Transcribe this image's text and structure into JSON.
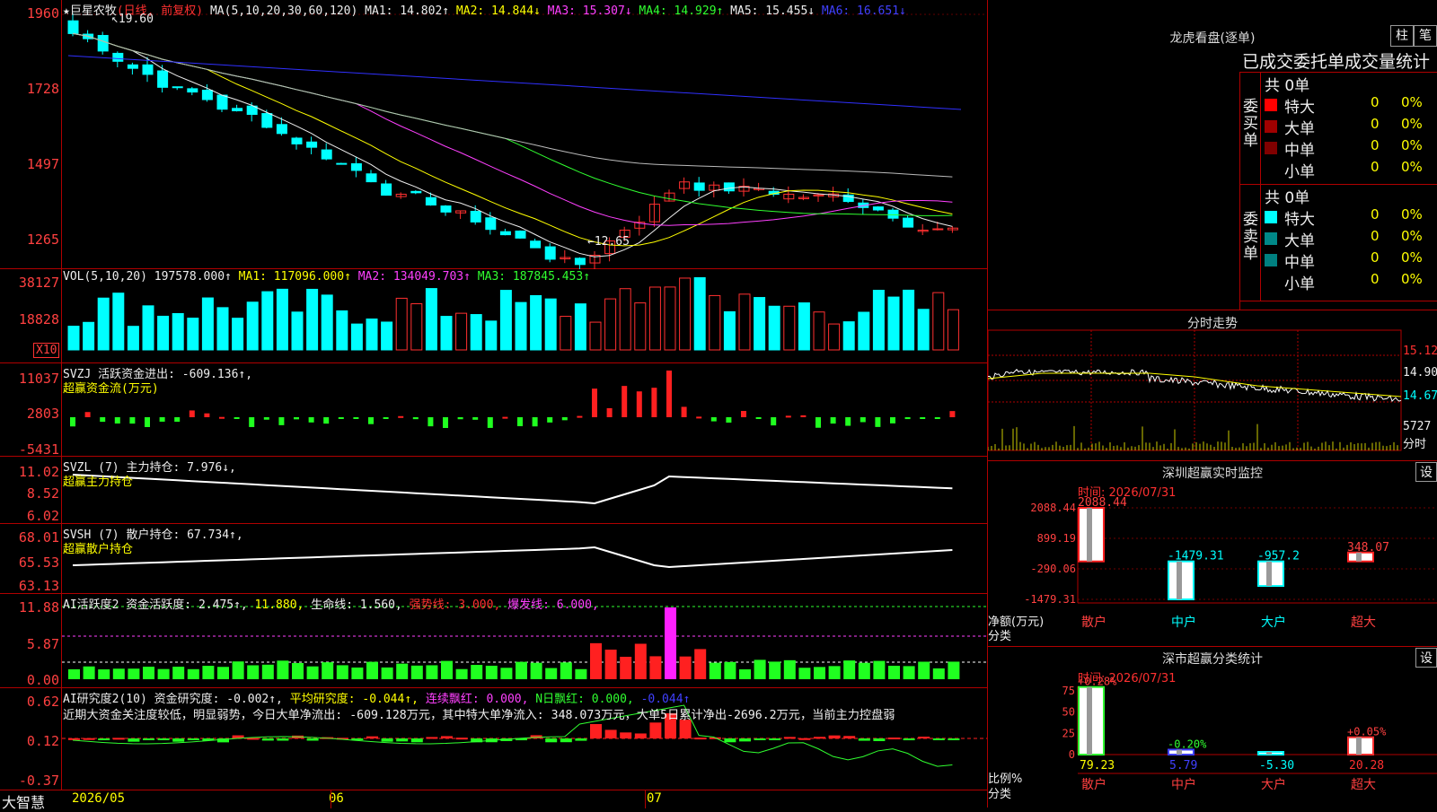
{
  "stock": {
    "name": "★巨星农牧",
    "period": "(日线, 前复权)",
    "ma_label": "MA(5,10,20,30,60,120)",
    "ma1": "MA1: 14.802↑",
    "ma2": "MA2: 14.844↓",
    "ma3": "MA3: 15.307↓",
    "ma4": "MA4: 14.929↑",
    "ma5": "MA5: 15.455↓",
    "ma6": "MA6: 16.651↓",
    "high_mark": "19.60",
    "low_mark": "12.65",
    "y_ticks": [
      "1960",
      "1728",
      "1497",
      "1265"
    ]
  },
  "vol": {
    "label": "VOL(5,10,20)",
    "value": "197578.000↑",
    "ma1": "MA1: 117096.000↑",
    "ma2": "MA2: 134049.703↑",
    "ma3": "MA3: 187845.453↑",
    "y_ticks": [
      "38127",
      "18828"
    ],
    "unit": "X10"
  },
  "svzj": {
    "label": "SVZJ  活跃资金进出: -609.136↑,",
    "sub": "超赢资金流(万元)",
    "y_ticks": [
      "11037",
      "2803",
      "-5431"
    ]
  },
  "svzl": {
    "label": "SVZL (7) 主力持仓: 7.976↓,",
    "sub": "超赢主力持仓",
    "y_ticks": [
      "11.02",
      "8.52",
      "6.02"
    ]
  },
  "svsh": {
    "label": "SVSH (7) 散户持仓: 67.734↑,",
    "sub": "超赢散户持仓",
    "y_ticks": [
      "68.01",
      "65.53",
      "63.13"
    ]
  },
  "ai1": {
    "label": "AI活跃度2 资金活跃度: 2.475↑,",
    "v2": "11.880,",
    "v3": "生命线: 1.560,",
    "v4": "强势线: 3.000,",
    "v5": "爆发线: 6.000,",
    "y_ticks": [
      "11.88",
      "5.87",
      "0.00"
    ]
  },
  "ai2": {
    "label": "AI研究度2(10) 资金研究度: -0.002↑,",
    "v2": "平均研究度: -0.044↑,",
    "v3": "连续飘红: 0.000,",
    "v4": "N日飘红: 0.000,",
    "v5": "-0.044↑",
    "comment": "近期大资金关注度较低，明显弱势，今日大单净流出: -609.128万元，其中特大单净流入: 348.073万元，大单5日累计净出-2696.2万元，当前主力控盘弱",
    "y_ticks": [
      "0.62",
      "0.12",
      "-0.37"
    ]
  },
  "footer": {
    "brand": "大智慧",
    "dates": [
      "2026/05",
      "06",
      "07"
    ]
  },
  "lhb": {
    "title": "龙虎看盘(逐单)",
    "btn1": "柱",
    "btn2": "笔",
    "subtitle": "已成交委托单成交量统计",
    "buy_label": "委买单",
    "sell_label": "委卖单",
    "buy_total": "共 0单",
    "sell_total": "共 0单",
    "buy_rows": [
      {
        "name": "特大",
        "vol": "0",
        "pct": "0%",
        "color": "#ff0000"
      },
      {
        "name": "大单",
        "vol": "0",
        "pct": "0%",
        "color": "#a00000"
      },
      {
        "name": "中单",
        "vol": "0",
        "pct": "0%",
        "color": "#800000"
      },
      {
        "name": "小单",
        "vol": "0",
        "pct": "0%",
        "color": ""
      }
    ],
    "sell_rows": [
      {
        "name": "特大",
        "vol": "0",
        "pct": "0%",
        "color": "#00ffff"
      },
      {
        "name": "大单",
        "vol": "0",
        "pct": "0%",
        "color": "#008888"
      },
      {
        "name": "中单",
        "vol": "0",
        "pct": "0%",
        "color": "#008080"
      },
      {
        "name": "小单",
        "vol": "0",
        "pct": "0%",
        "color": ""
      }
    ]
  },
  "intraday": {
    "title": "分时走势",
    "prices": [
      "15.12",
      "14.90",
      "14.67"
    ],
    "vol": "5727",
    "unit": "分时"
  },
  "monitor": {
    "title": "深圳超赢实时监控",
    "btn": "设",
    "time": "时间: 2026/07/31",
    "y_ticks": [
      "2088.44",
      "899.19",
      "-290.06",
      "-1479.31"
    ],
    "ylabel1": "净额(万元)",
    "ylabel2": "分类"
  },
  "classify": {
    "title": "深市超赢分类统计",
    "btn": "设",
    "time": "时间: 2026/07/31",
    "y_ticks": [
      "75",
      "50",
      "25",
      "0"
    ],
    "ylabel1": "比例%",
    "ylabel2": "分类"
  },
  "chart_data": [
    {
      "type": "bar",
      "title": "深圳超赢实时监控",
      "categories": [
        "散户",
        "中户",
        "大户",
        "超大"
      ],
      "values": [
        2088.44,
        -1479.31,
        -957.2,
        348.07
      ],
      "labels": [
        "2088.44",
        "-1479.31",
        "-957.2",
        "348.07"
      ],
      "ylim": [
        -1479.31,
        2088.44
      ]
    },
    {
      "type": "bar",
      "title": "深市超赢分类统计",
      "categories": [
        "散户",
        "中户",
        "大户",
        "超大"
      ],
      "values": [
        79.23,
        5.79,
        -5.3,
        20.28
      ],
      "labels": [
        "79.23",
        "5.79",
        "-5.30",
        "20.28"
      ],
      "changes": [
        "+0.28%",
        "-0.20%",
        "",
        "+0.05%"
      ],
      "ylim": [
        0,
        80
      ]
    }
  ]
}
